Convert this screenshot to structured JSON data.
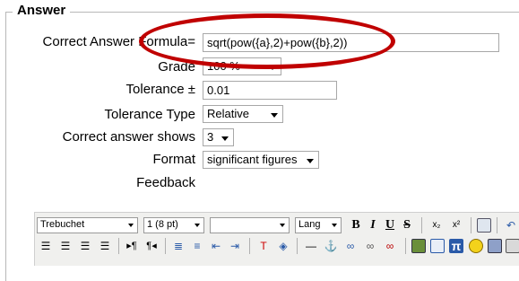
{
  "section": {
    "title": "Answer"
  },
  "fields": {
    "formula": {
      "label": "Correct Answer Formula=",
      "value": "sqrt(pow({a},2)+pow({b},2))"
    },
    "grade": {
      "label": "Grade",
      "value": "100 %"
    },
    "tolerance": {
      "label": "Tolerance ±",
      "value": "0.01"
    },
    "tolerance_type": {
      "label": "Tolerance Type",
      "value": "Relative"
    },
    "answer_shows": {
      "label": "Correct answer shows",
      "value": "3"
    },
    "format": {
      "label": "Format",
      "value": "significant figures"
    },
    "feedback": {
      "label": "Feedback"
    }
  },
  "editor": {
    "font": "Trebuchet",
    "size": "1 (8 pt)",
    "style": "",
    "lang": "Lang",
    "bold": "B",
    "italic": "I",
    "underline": "U",
    "strike": "S",
    "subscript": "x₂",
    "superscript": "x²"
  },
  "colors": {
    "highlight_oval": "#c00000"
  }
}
